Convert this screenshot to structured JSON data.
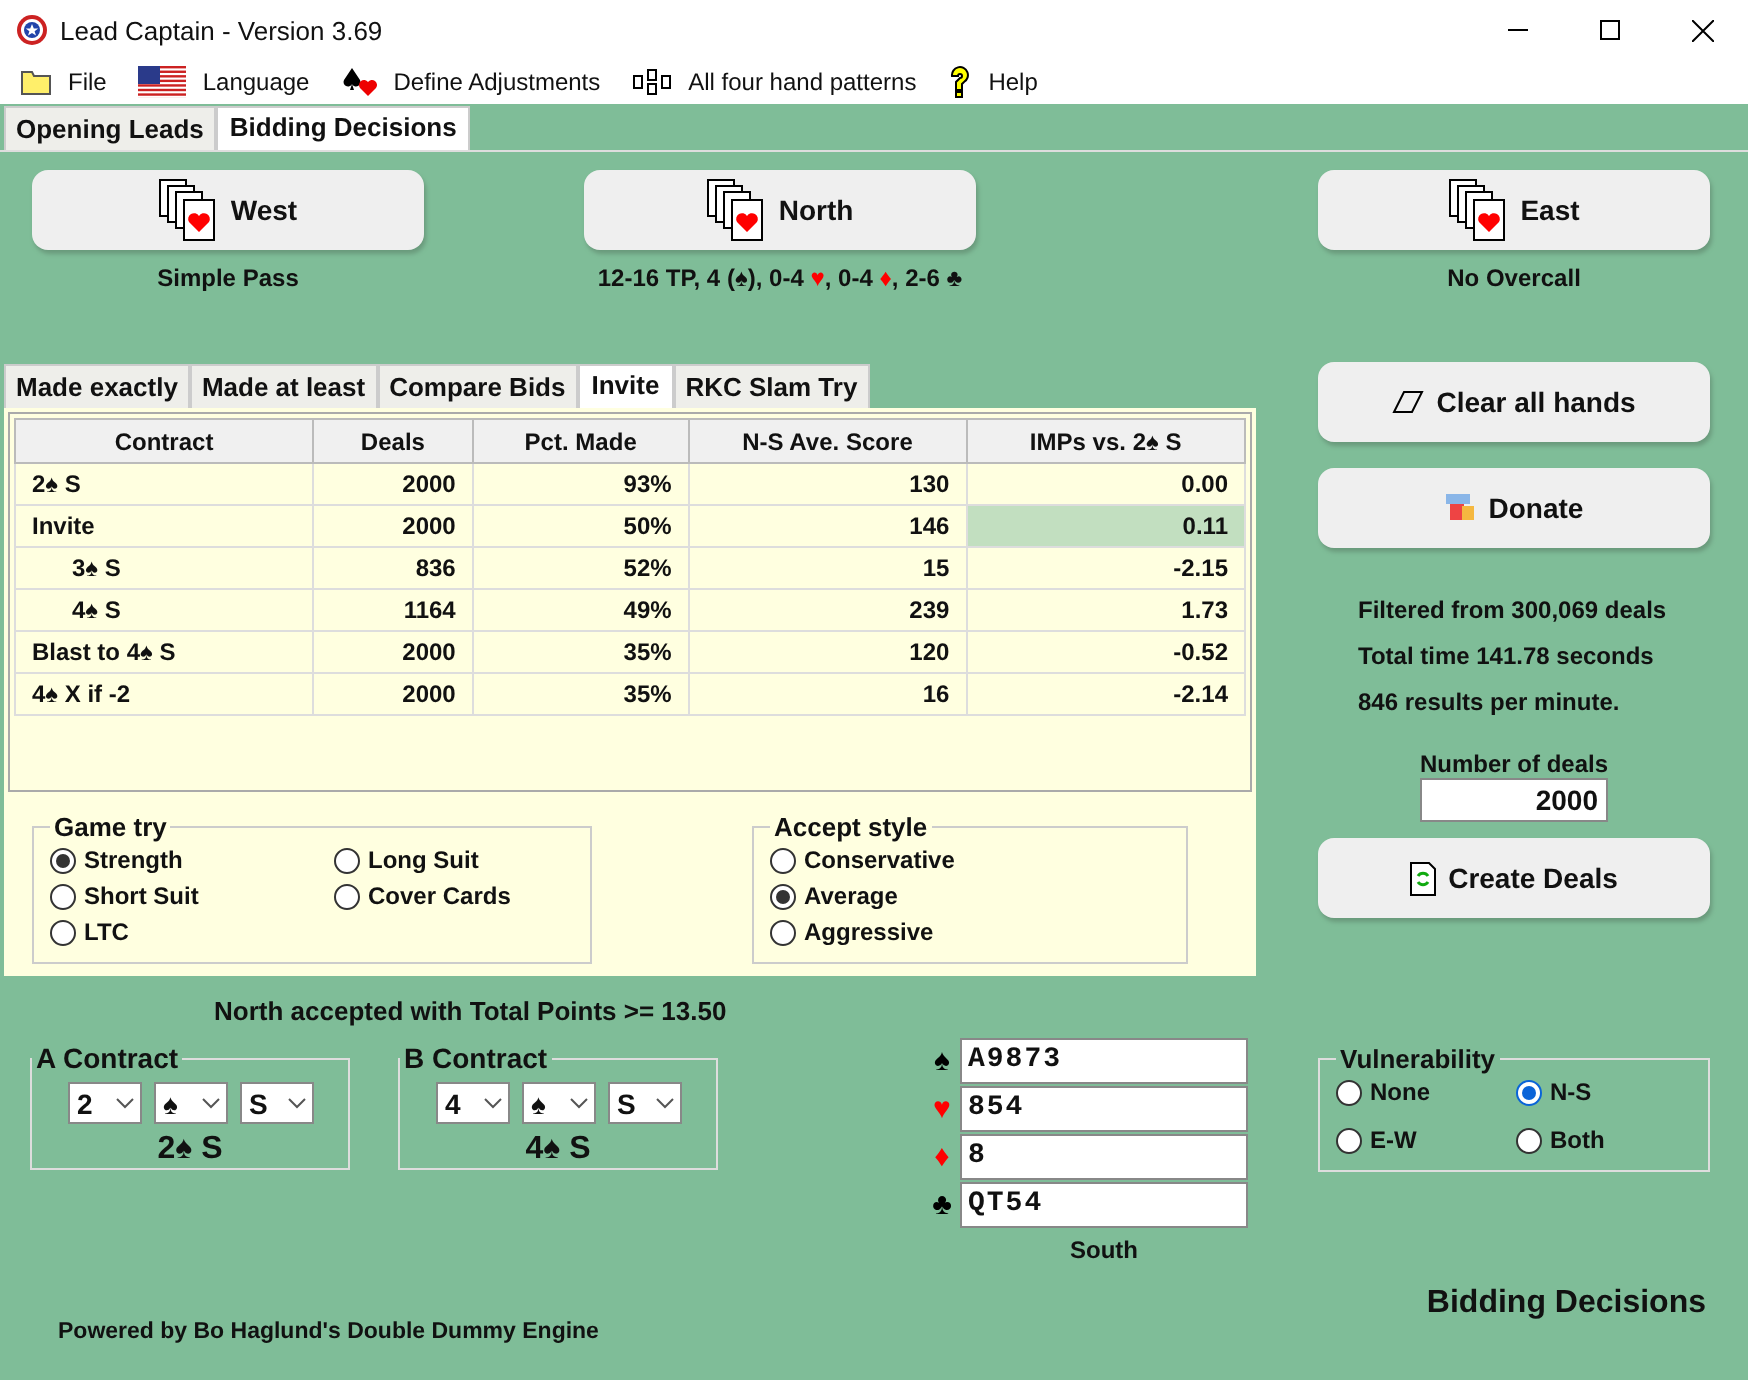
{
  "window": {
    "title": "Lead Captain - Version 3.69"
  },
  "menu": [
    {
      "kind": "folder",
      "label": "File"
    },
    {
      "kind": "flag",
      "label": "Language"
    },
    {
      "kind": "suits",
      "label": "Define Adjustments"
    },
    {
      "kind": "pattern",
      "label": "All four hand patterns"
    },
    {
      "kind": "help",
      "label": "Help"
    }
  ],
  "main_tabs": [
    {
      "label": "Opening Leads",
      "selected": false
    },
    {
      "label": "Bidding Decisions",
      "selected": true
    }
  ],
  "seats": [
    {
      "label": "West",
      "description": "Simple Pass"
    },
    {
      "label": "North",
      "description": "12-16 TP, 4 (♠), 0-4 ♥, 0-4 ♦, 2-6 ♣"
    },
    {
      "label": "East",
      "description": "No Overcall"
    }
  ],
  "result_tabs": [
    {
      "label": "Made exactly",
      "selected": false
    },
    {
      "label": "Made at least",
      "selected": false
    },
    {
      "label": "Compare Bids",
      "selected": false
    },
    {
      "label": "Invite",
      "selected": true
    },
    {
      "label": "RKC Slam Try",
      "selected": false
    }
  ],
  "table": {
    "columns": [
      "Contract",
      "Deals",
      "Pct. Made",
      "N-S Ave. Score",
      "IMPs vs. 2♠ S"
    ],
    "rows": [
      {
        "cells": [
          "2♠ S",
          "2000",
          "93%",
          "130",
          "0.00"
        ],
        "highlight": false
      },
      {
        "cells": [
          "Invite",
          "2000",
          "50%",
          "146",
          "0.11"
        ],
        "highlight": true,
        "children": [
          {
            "cells": [
              "3♠ S",
              "836",
              "52%",
              "15",
              "-2.15"
            ],
            "highlight": false
          },
          {
            "cells": [
              "4♠ S",
              "1164",
              "49%",
              "239",
              "1.73"
            ],
            "highlight": false
          }
        ]
      },
      {
        "cells": [
          "Blast to 4♠ S",
          "2000",
          "35%",
          "120",
          "-0.52"
        ],
        "highlight": false
      },
      {
        "cells": [
          "4♠ X  if -2",
          "2000",
          "35%",
          "16",
          "-2.14"
        ],
        "highlight": false
      }
    ]
  },
  "game_try": {
    "title": "Game try",
    "options": [
      {
        "label": "Strength",
        "selected": true
      },
      {
        "label": "Long Suit",
        "selected": false
      },
      {
        "label": "Short Suit",
        "selected": false
      },
      {
        "label": "Cover Cards",
        "selected": false
      },
      {
        "label": "LTC",
        "selected": false
      }
    ]
  },
  "accept_style": {
    "title": "Accept style",
    "options": [
      {
        "label": "Conservative",
        "selected": false
      },
      {
        "label": "Average",
        "selected": true
      },
      {
        "label": "Aggressive",
        "selected": false
      }
    ]
  },
  "message": "North accepted with Total Points >= 13.50",
  "contracts": [
    {
      "title": "A Contract",
      "level": "2",
      "strain": "♠",
      "declarer": "S",
      "result": "2♠ S"
    },
    {
      "title": "B Contract",
      "level": "4",
      "strain": "♠",
      "declarer": "S",
      "result": "4♠ S"
    }
  ],
  "south": {
    "label": "South",
    "suits": [
      {
        "symbol": "♠",
        "color": "#000000",
        "cards": "A9873"
      },
      {
        "symbol": "♥",
        "color": "#ff0000",
        "cards": "854"
      },
      {
        "symbol": "♦",
        "color": "#ff0000",
        "cards": "8"
      },
      {
        "symbol": "♣",
        "color": "#000000",
        "cards": "QT54"
      }
    ]
  },
  "powered_by": "Powered by Bo Haglund's  Double Dummy Engine",
  "clear_button": "Clear all hands",
  "donate_button": "Donate",
  "stats": [
    "Filtered from 300,069 deals",
    "Total time 141.78 seconds",
    "846 results per minute."
  ],
  "deals": {
    "label": "Number of deals",
    "value": "2000"
  },
  "create_button": "Create Deals",
  "vulnerability": {
    "title": "Vulnerability",
    "options": [
      {
        "label": "None",
        "selected": false
      },
      {
        "label": "N-S",
        "selected": true
      },
      {
        "label": "E-W",
        "selected": false
      },
      {
        "label": "Both",
        "selected": false
      }
    ]
  },
  "footer": "Bidding Decisions"
}
